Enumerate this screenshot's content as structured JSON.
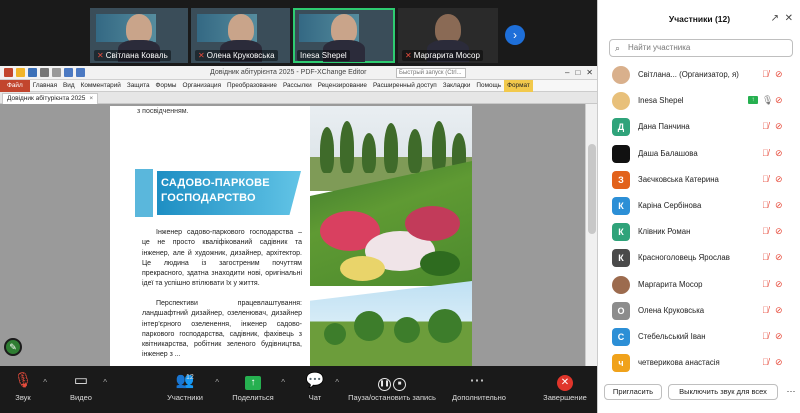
{
  "video_strip": {
    "tiles": [
      {
        "name": "Світлана Коваль",
        "muted": true,
        "active": false
      },
      {
        "name": "Олена Круковська",
        "muted": true,
        "active": false
      },
      {
        "name": "Inesa Shepel",
        "muted": false,
        "active": true
      },
      {
        "name": "Маргарита Мосор",
        "muted": true,
        "active": false
      }
    ],
    "next_icon": "chevron-right-icon"
  },
  "app": {
    "title": "Довідник абітурієнта 2025 - PDF-XChange Editor",
    "search_placeholder": "Быстрый запуск (Ctrl...",
    "menu": [
      "Файл",
      "Главная",
      "Вид",
      "Комментарий",
      "Защита",
      "Формы",
      "Организация",
      "Преобразование",
      "Рассылки",
      "Рецензирование",
      "Расширенный доступ",
      "Закладки",
      "Помощь",
      "Формат"
    ],
    "doc_tab": "Довідник абітурієнта 2025"
  },
  "document": {
    "top_line": "з посвідченням.",
    "heading": "САДОВО-ПАРКОВЕ ГОСПОДАРСТВО",
    "paragraph1": "Інженер садово-паркового господарства – це не просто кваліфікований садівник та інженер, але й художник, дизайнер, архітектор. Це людина із загостреним почуттям прекрасного, здатна знаходити нові, оригінальні ідеї та успішно втілювати їх у життя.",
    "paragraph2": "Перспективи працевлаштування: ландшафтний дизайнер, озеленювач, дизайнер інтер'єрного озеленення, інженер садово-паркового господарства, садівник, фахівець з квітникарства, робітник зеленого будівництва, інженер з ..."
  },
  "toolbar": {
    "mic_label": "Звук",
    "video_label": "Видео",
    "participants_label": "Участники",
    "participants_count": "12",
    "share_label": "Поделиться",
    "chat_label": "Чат",
    "record_label": "Пауза/остановить запись",
    "more_label": "Дополнительно",
    "end_label": "Завершение"
  },
  "panel": {
    "title": "Участники (12)",
    "search_placeholder": "Найти участника",
    "participants": [
      {
        "name": "Світлана... (Организатор, я)",
        "initial": "",
        "color": "#d9b08c",
        "photo": true,
        "mic_muted": true,
        "cam_off": true,
        "sharing": false
      },
      {
        "name": "Inesa Shepel",
        "initial": "",
        "color": "#e8c07a",
        "photo": true,
        "mic_muted": false,
        "cam_off": true,
        "sharing": true
      },
      {
        "name": "Дана Панчина",
        "initial": "Д",
        "color": "#2fa37a",
        "photo": false,
        "mic_muted": true,
        "cam_off": true,
        "sharing": false
      },
      {
        "name": "Даша Балашова",
        "initial": "",
        "color": "#111111",
        "photo": false,
        "mic_muted": true,
        "cam_off": true,
        "sharing": false
      },
      {
        "name": "Заєчковська Катерина",
        "initial": "З",
        "color": "#e2621b",
        "photo": false,
        "mic_muted": true,
        "cam_off": true,
        "sharing": false
      },
      {
        "name": "Каріна Сербінова",
        "initial": "К",
        "color": "#2c8fd6",
        "photo": false,
        "mic_muted": true,
        "cam_off": true,
        "sharing": false
      },
      {
        "name": "Клівник Роман",
        "initial": "К",
        "color": "#2fa37a",
        "photo": false,
        "mic_muted": true,
        "cam_off": true,
        "sharing": false
      },
      {
        "name": "Красноголовець Ярослав",
        "initial": "К",
        "color": "#4a4a4a",
        "photo": false,
        "mic_muted": true,
        "cam_off": true,
        "sharing": false
      },
      {
        "name": "Маргарита Мосор",
        "initial": "",
        "color": "#9c6b4e",
        "photo": true,
        "mic_muted": true,
        "cam_off": true,
        "sharing": false
      },
      {
        "name": "Олена Круковська",
        "initial": "О",
        "color": "#8c8c8c",
        "photo": false,
        "mic_muted": true,
        "cam_off": true,
        "sharing": false
      },
      {
        "name": "Стебельський Іван",
        "initial": "С",
        "color": "#2c8fd6",
        "photo": false,
        "mic_muted": true,
        "cam_off": true,
        "sharing": false
      },
      {
        "name": "четверикова анастасія",
        "initial": "ч",
        "color": "#f0a21b",
        "photo": false,
        "mic_muted": true,
        "cam_off": true,
        "sharing": false
      }
    ],
    "invite_label": "Пригласить",
    "mute_all_label": "Выключить звук для всех"
  }
}
